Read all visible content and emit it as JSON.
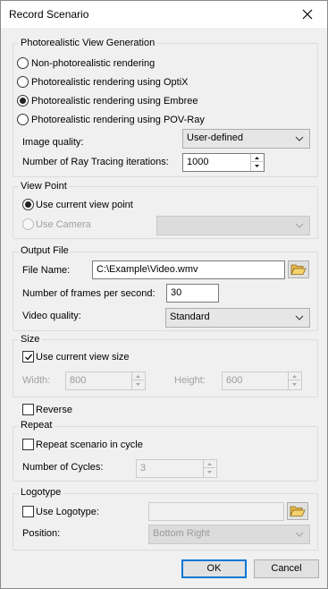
{
  "window": {
    "title": "Record Scenario"
  },
  "photorealistic": {
    "group_label": "Photorealistic View Generation",
    "options": [
      {
        "label": "Non-photorealistic rendering",
        "checked": false
      },
      {
        "label": "Photorealistic rendering using OptiX",
        "checked": false
      },
      {
        "label": "Photorealistic rendering using Embree",
        "checked": true
      },
      {
        "label": "Photorealistic rendering using POV-Ray",
        "checked": false
      }
    ],
    "image_quality_label": "Image quality:",
    "image_quality_value": "User-defined",
    "iterations_label": "Number of Ray Tracing iterations:",
    "iterations_value": "1000"
  },
  "viewpoint": {
    "group_label": "View Point",
    "use_current_label": "Use current view point",
    "use_camera_label": "Use Camera",
    "camera_value": ""
  },
  "output": {
    "group_label": "Output File",
    "file_name_label": "File Name:",
    "file_name_value": "C:\\Example\\Video.wmv",
    "fps_label": "Number of frames per second:",
    "fps_value": "30",
    "video_quality_label": "Video quality:",
    "video_quality_value": "Standard"
  },
  "size": {
    "group_label": "Size",
    "use_current_size_label": "Use current view size",
    "width_label": "Width:",
    "width_value": "800",
    "height_label": "Height:",
    "height_value": "600"
  },
  "reverse_label": "Reverse",
  "repeat": {
    "group_label": "Repeat",
    "repeat_cycle_label": "Repeat scenario in cycle",
    "cycles_label": "Number of Cycles:",
    "cycles_value": "3"
  },
  "logotype": {
    "group_label": "Logotype",
    "use_logotype_label": "Use Logotype:",
    "logotype_value": "",
    "position_label": "Position:",
    "position_value": "Bottom Right"
  },
  "buttons": {
    "ok": "OK",
    "cancel": "Cancel"
  }
}
